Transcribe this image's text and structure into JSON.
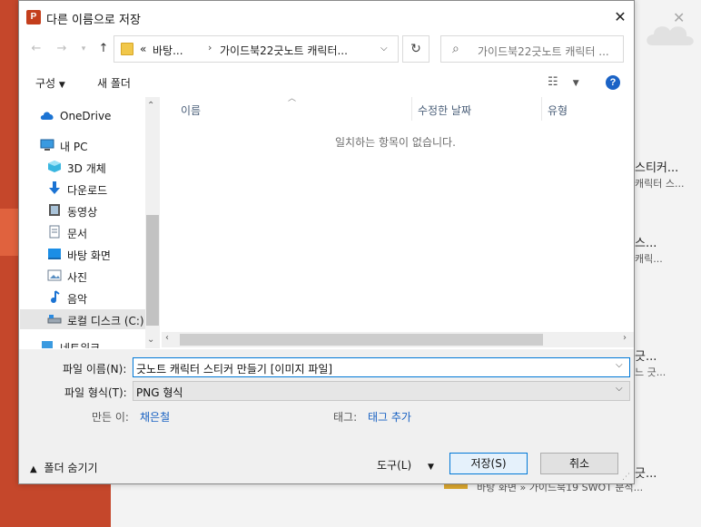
{
  "background": {
    "entries": [
      {
        "title": "스티커...",
        "subtitle": "캐릭터 스..."
      },
      {
        "title": "스...",
        "subtitle": "캐릭..."
      },
      {
        "title": "긋...",
        "subtitle": "느 긋..."
      },
      {
        "title": "긋...",
        "subtitle": ""
      }
    ],
    "bottom_crumb": "바탕 화면 » 가이드북19 SWOT 분석..."
  },
  "dialog": {
    "title": "다른 이름으로 저장",
    "app_icon_letter": "P",
    "address": {
      "overflow": "«",
      "crumbs": [
        "바탕...",
        "가이드북22긋노트 캐릭터..."
      ]
    },
    "search_placeholder": "가이드북22긋노트 캐릭터 ...",
    "toolbar": {
      "organize": "구성",
      "new_folder": "새 폴더"
    },
    "nav": [
      {
        "label": "OneDrive",
        "icon": "cloud-icon"
      },
      {
        "label": "내 PC",
        "icon": "pc-icon"
      },
      {
        "label": "3D 개체",
        "icon": "cube-icon"
      },
      {
        "label": "다운로드",
        "icon": "download-icon"
      },
      {
        "label": "동영상",
        "icon": "video-icon"
      },
      {
        "label": "문서",
        "icon": "document-icon"
      },
      {
        "label": "바탕 화면",
        "icon": "desktop-icon"
      },
      {
        "label": "사진",
        "icon": "picture-icon"
      },
      {
        "label": "음악",
        "icon": "music-icon"
      },
      {
        "label": "로컬 디스크 (C:)",
        "icon": "drive-icon"
      },
      {
        "label": "네트워크",
        "icon": "network-icon"
      }
    ],
    "columns": [
      "이름",
      "수정한 날짜",
      "유형"
    ],
    "empty_message": "일치하는 항목이 없습니다.",
    "form": {
      "filename_label": "파일 이름(N):",
      "filename_value": "긋노트 캐릭터 스티커 만들기 [이미지 파일]",
      "filetype_label": "파일 형식(T):",
      "filetype_value": "PNG 형식",
      "author_label": "만든 이:",
      "author_value": "채은철",
      "tags_label": "태그:",
      "tags_value": "태그 추가"
    },
    "footer": {
      "hide_folders": "폴더 숨기기",
      "tools": "도구(L)",
      "save": "저장(S)",
      "cancel": "취소"
    }
  }
}
